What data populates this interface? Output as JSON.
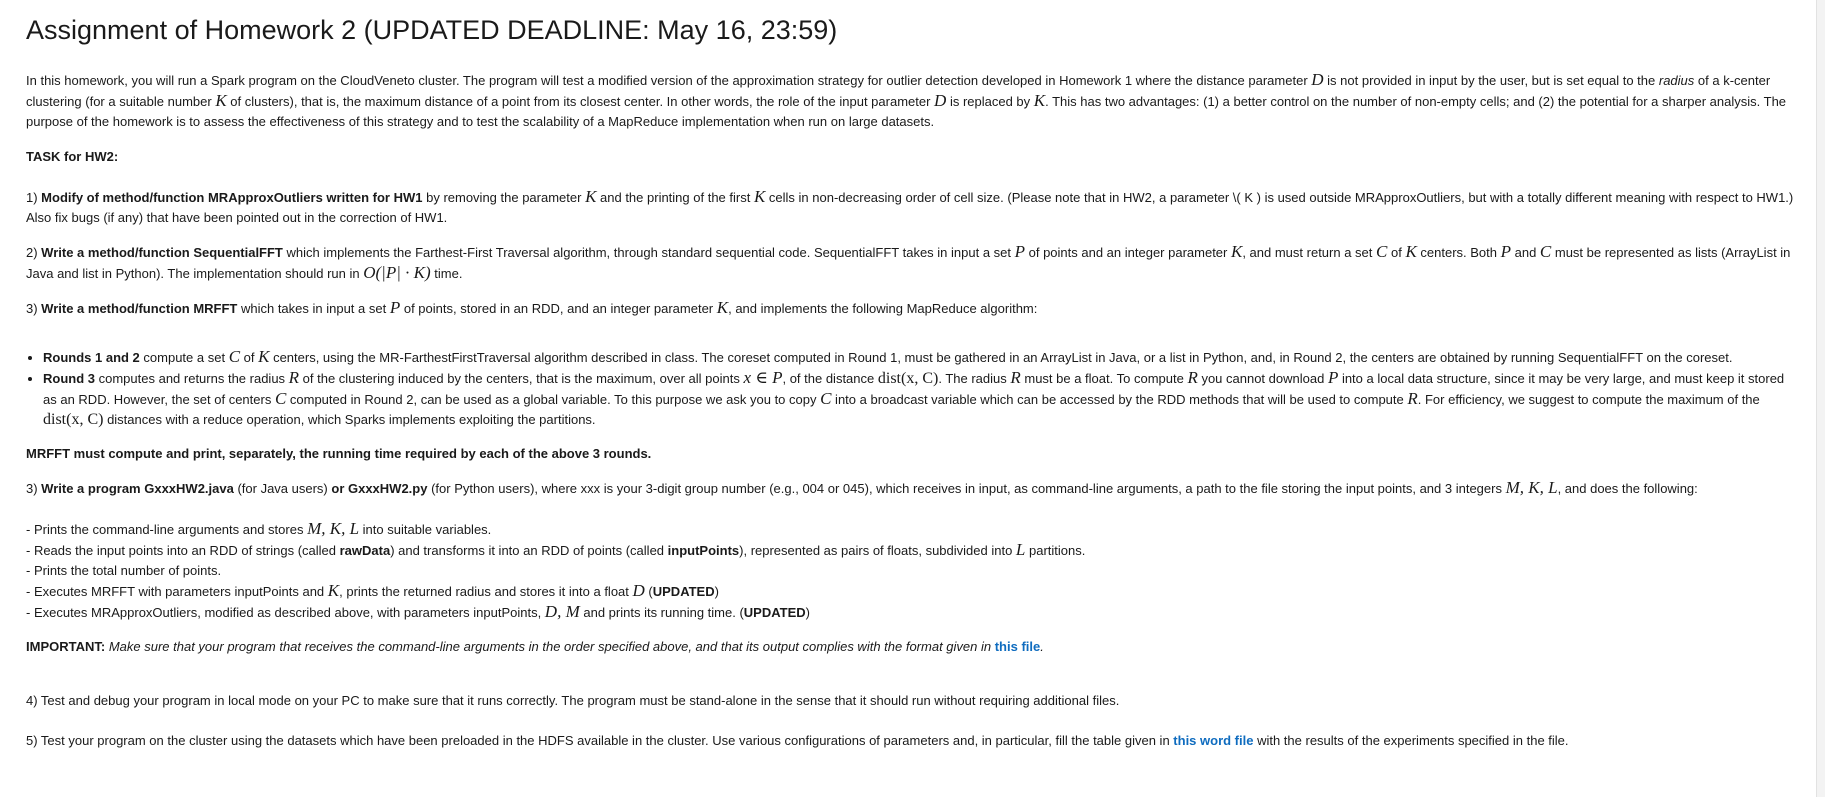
{
  "title": "Assignment of Homework 2 (UPDATED DEADLINE: May 16, 23:59)",
  "intro": {
    "t1": "In this homework, you will run a Spark program on the CloudVeneto cluster. The program will test a modified version of the approximation strategy for outlier detection developed in Homework 1 where the distance parameter ",
    "t2": " is not provided in input by the user, but is set equal to the ",
    "radius_word": "radius",
    "t3": " of a k-center clustering (for a suitable number ",
    "t4": " of clusters), that is, the maximum distance of a point from its closest center. In other words, the role of the input parameter ",
    "t5": " is replaced by ",
    "t6": ". This has two advantages: (1) a better control on the number of non-empty cells; and (2) the potential for a sharper analysis. The purpose of the homework is to assess the effectiveness of this strategy and to test the scalability of a MapReduce implementation when run on large datasets."
  },
  "task_heading": "TASK for HW2:",
  "item1": {
    "num": "1) ",
    "bold": "Modify of method/function MRApproxOutliers written for HW1",
    "t1": " by removing the parameter ",
    "t2": " and the printing of the first ",
    "t3": " cells in non-decreasing order of cell size. (Please note that in HW2, a parameter \\( K ) is used outside MRApproxOutliers, but with a totally different meaning with respect to HW1.) Also fix bugs (if any) that have been pointed out in the correction of HW1."
  },
  "item2": {
    "num": "2) ",
    "bold": "Write a method/function SequentialFFT",
    "t1": " which implements the Farthest-First Traversal algorithm, through standard sequential code. SequentialFFT takes in input a set ",
    "t2": " of points and an integer  parameter ",
    "t3": ", and must return a set ",
    "t4": " of ",
    "t5": " centers. Both ",
    "t6": " and ",
    "t7": " must be represented as lists (ArrayList in Java and list in Python). The implementation should run in ",
    "complexity": "O(|P| · K)",
    "t8": " time."
  },
  "item3": {
    "num": "3) ",
    "bold": "Write a method/function MRFFT",
    "t1": " which takes in input a set ",
    "t2": " of points, stored in an RDD, and  an integer  parameter ",
    "t3": ", and implements the following MapReduce algorithm:"
  },
  "rounds": {
    "r12_bold": "Rounds 1 and 2",
    "r12_t1": " compute a set ",
    "r12_t2": " of ",
    "r12_t3": " centers, using the MR-FarthestFirstTraversal algorithm described in class. The coreset computed in Round 1, must be gathered in an ArrayList in Java, or a list in Python, and, in Round 2, the centers are obtained by running SequentialFFT on the coreset.",
    "r3_bold": "Round 3",
    "r3_t1": " computes and returns the radius ",
    "r3_t2": " of the clustering induced by the centers, that is the maximum, over all points ",
    "r3_t3": ", of the distance ",
    "r3_t4": ". The radius ",
    "r3_t5": " must be a float. To compute ",
    "r3_t6": " you cannot download ",
    "r3_t7": " into a local data structure, since it may be very large, and must keep it stored as an RDD. However, the set of centers ",
    "r3_t8": " computed in Round 2, can be used as a global variable. To this purpose we ask you to copy ",
    "r3_t9": " into a broadcast variable which can be accessed by the RDD methods that will be used to compute ",
    "r3_t10": ". For efficiency, we suggest to compute the maximum of the ",
    "r3_t11": " distances with a reduce operation, which Sparks implements exploiting the partitions."
  },
  "mrfft_note": "MRFFT must compute and print, separately, the running time required by each of the above 3 rounds.",
  "item4": {
    "num": "3) ",
    "bold1": "Write a program GxxxHW2.java",
    "t1": " (for Java users) ",
    "bold2": "or GxxxHW2.py",
    "t2": " (for Python users), where xxx is your 3-digit group number (e.g., 004 or 045), which receives in input, as command-line arguments, a path to the file storing the input points,  and 3 integers ",
    "t3": ", and does the following:"
  },
  "steps": {
    "s1a": "- Prints the command-line arguments and stores ",
    "s1b": " into suitable variables.",
    "s2a": "- Reads the input points into an RDD of strings (called ",
    "s2b": "rawData",
    "s2c": ") and transforms it into an RDD of points (called ",
    "s2d": "inputPoints",
    "s2e": "), represented as pairs of floats, subdivided into ",
    "s2f": " partitions.",
    "s3": "- Prints the total number of points.",
    "s4a": "- Executes MRFFT with parameters inputPoints and ",
    "s4b": ", prints the returned radius and stores it into a float ",
    "s4c": " (",
    "s4d": "UPDATED",
    "s4e": ")",
    "s5a": "- Executes MRApproxOutliers, modified as described above, with parameters inputPoints, ",
    "s5b": " and prints its running time. (",
    "s5c": "UPDATED",
    "s5d": ")"
  },
  "important": {
    "bold": "IMPORTANT:",
    "italic": " Make sure that your program that receives the command-line arguments in the order specified above, and that its output complies with the format given in ",
    "link": "this file",
    "end": "."
  },
  "item5": "4) Test and debug your program in local mode on your PC to make sure that it runs correctly. The program must be stand-alone in the sense that it should run without requiring additional files.",
  "item6": {
    "t1": "5) Test your program on the cluster using the datasets which have been preloaded in the HDFS available in the cluster. Use various configurations of parameters and, in particular, fill the table given in ",
    "link": "this word file",
    "t2": " with the results of the experiments specified in the file."
  },
  "sym": {
    "D": "D",
    "K": "K",
    "P": "P",
    "C": "C",
    "R": "R",
    "x_in_P": "x ∈ P",
    "dist_xC": "dist(x, C)",
    "MKL": "M, K, L",
    "L": "L",
    "DM": "D, M"
  }
}
